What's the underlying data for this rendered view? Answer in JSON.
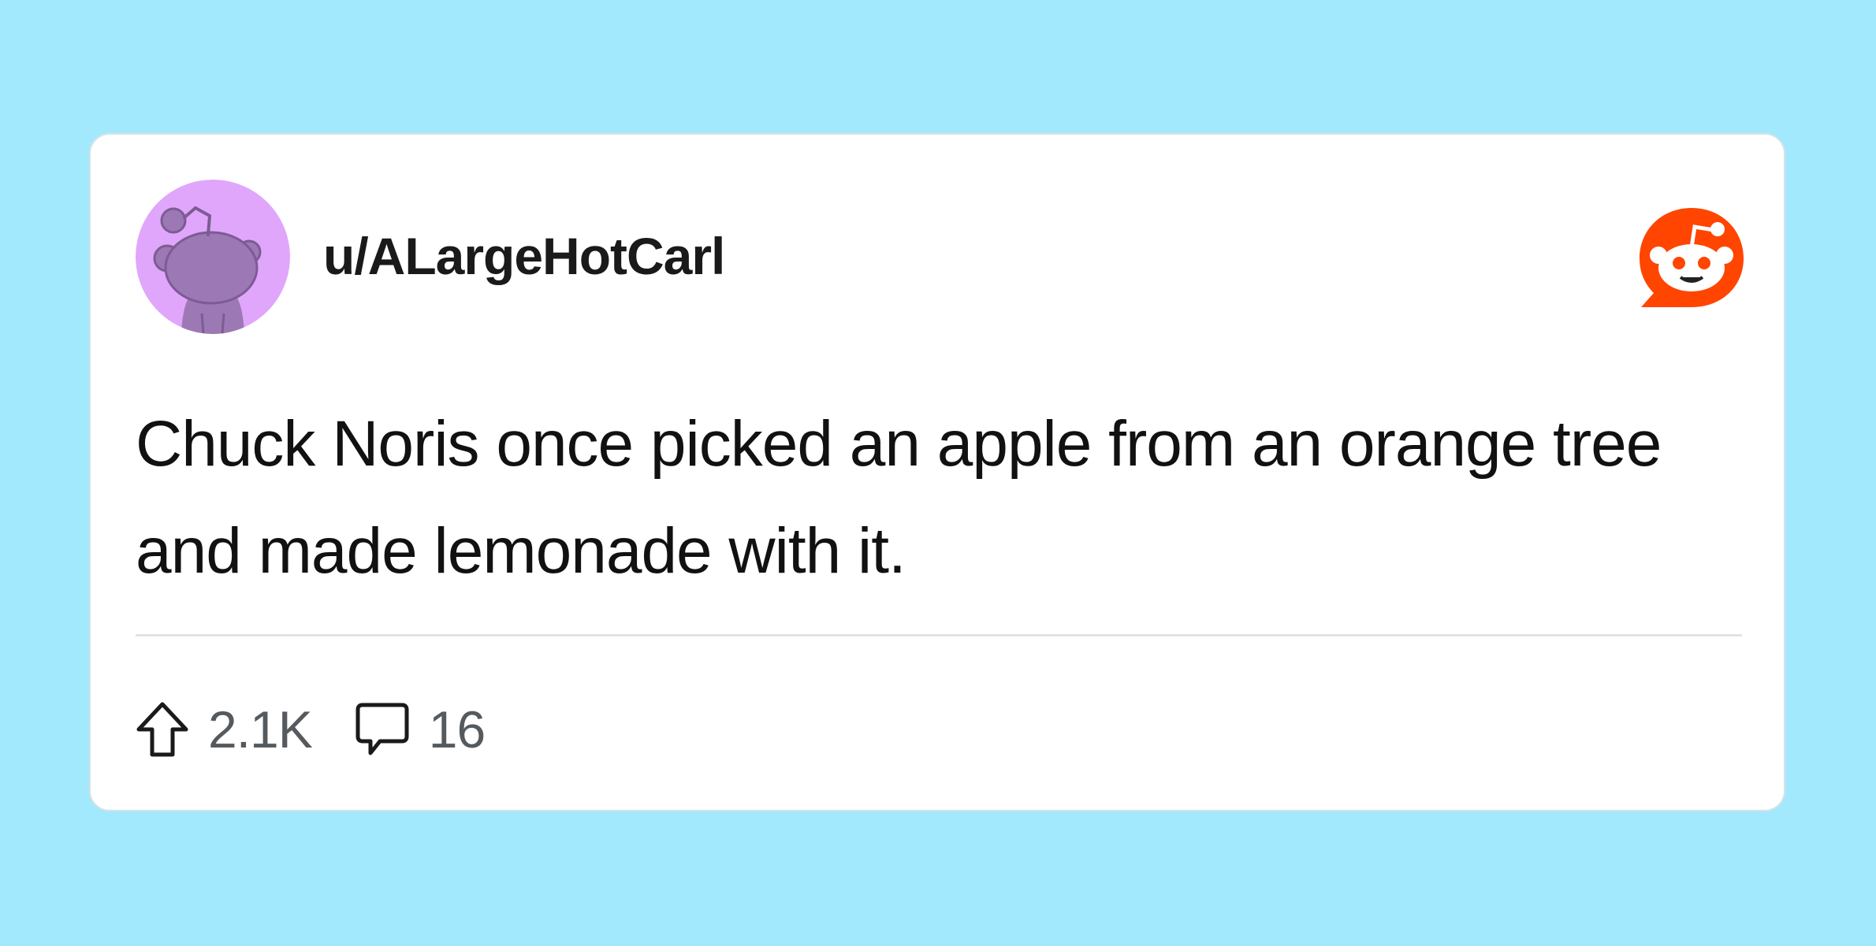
{
  "post": {
    "username": "u/ALargeHotCarl",
    "body_lines": [
      "Chuck Noris once picked an apple from an orange tree",
      "and made lemonade with it."
    ],
    "upvotes": "2.1K",
    "comments": "16"
  },
  "icons": {
    "avatar": "snoo-avatar",
    "logo": "reddit-logo-icon",
    "upvote": "upvote-arrow-icon",
    "comment": "comment-bubble-icon"
  },
  "colors": {
    "background": "#a3e9fd",
    "card": "#ffffff",
    "avatar_bg": "#e0a6fb",
    "avatar_snoo": "#9c78b5",
    "reddit_orange": "#ff4500",
    "text": "#111111",
    "muted_text": "#555a5e"
  }
}
